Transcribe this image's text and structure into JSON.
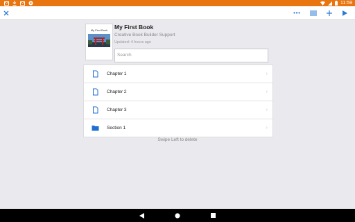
{
  "status_bar": {
    "time": "11:59",
    "left_icons": [
      "mail-icon",
      "download-icon",
      "mail-icon",
      "sync-icon"
    ],
    "right_icons": [
      "wifi-icon",
      "signal-icon",
      "battery-icon"
    ],
    "color": "#e8750f"
  },
  "toolbar": {
    "left_icon": "close-icon",
    "right_icons": [
      "more-icon",
      "list-icon",
      "add-icon",
      "play-icon"
    ],
    "accent": "#2a7bd3"
  },
  "book": {
    "cover_title": "My First Book",
    "title": "My First Book",
    "author": "Creative Book Builder Support",
    "updated": "Updated: 4 hours ago"
  },
  "search": {
    "placeholder": "Search"
  },
  "items": [
    {
      "label": "Chapter 1",
      "icon": "document-icon"
    },
    {
      "label": "Chapter 2",
      "icon": "document-icon"
    },
    {
      "label": "Chapter 3",
      "icon": "document-icon"
    },
    {
      "label": "Section 1",
      "icon": "folder-icon"
    }
  ],
  "chevron": "›",
  "hint": "Swipe Left to delete",
  "nav_bar": {
    "icons": [
      "back-icon",
      "home-icon",
      "recents-icon"
    ]
  }
}
